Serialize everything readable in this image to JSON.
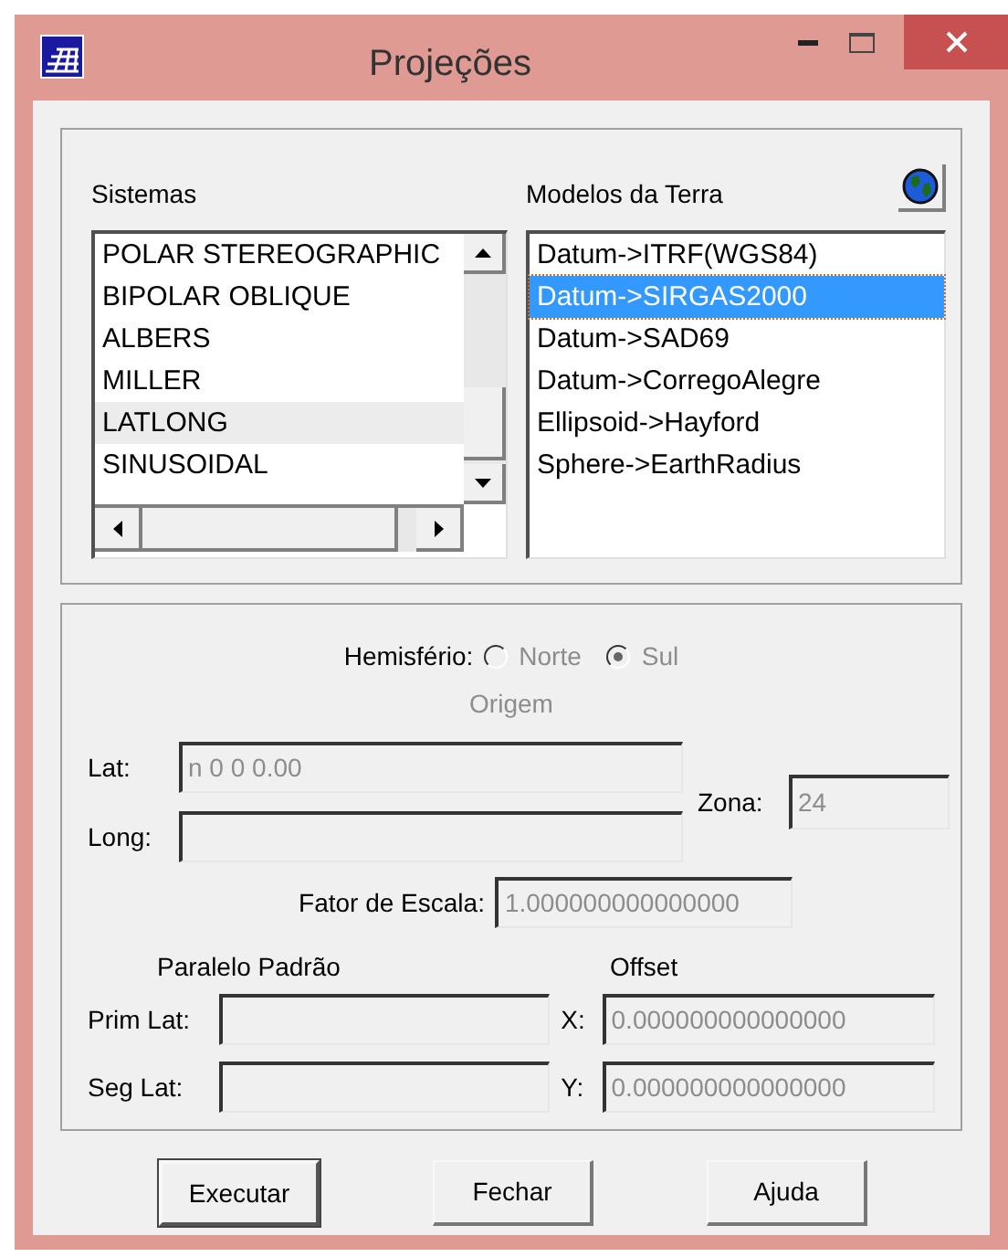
{
  "window": {
    "title": "Projeções"
  },
  "sistemas": {
    "label": "Sistemas",
    "items": [
      {
        "text": "POLAR STEREOGRAPHIC",
        "selected": false
      },
      {
        "text": "BIPOLAR OBLIQUE",
        "selected": false
      },
      {
        "text": "ALBERS",
        "selected": false
      },
      {
        "text": "MILLER",
        "selected": false
      },
      {
        "text": "LATLONG",
        "selected": true
      },
      {
        "text": "SINUSOIDAL",
        "selected": false
      }
    ]
  },
  "modelos": {
    "label": "Modelos da Terra",
    "items": [
      {
        "text": "Datum->ITRF(WGS84)",
        "selected": false
      },
      {
        "text": "Datum->SIRGAS2000",
        "selected": true
      },
      {
        "text": "Datum->SAD69",
        "selected": false
      },
      {
        "text": "Datum->CorregoAlegre",
        "selected": false
      },
      {
        "text": "Ellipsoid->Hayford",
        "selected": false
      },
      {
        "text": "Sphere->EarthRadius",
        "selected": false
      }
    ]
  },
  "hemisferio": {
    "label": "Hemisfério:",
    "disabled": true,
    "options": [
      {
        "label": "Norte",
        "selected": false
      },
      {
        "label": "Sul",
        "selected": true
      }
    ]
  },
  "origem": {
    "label": "Origem",
    "disabled": true
  },
  "lat": {
    "label": "Lat:",
    "value": "n 0 0 0.00",
    "disabled": true
  },
  "long": {
    "label": "Long:",
    "disabled": true
  },
  "zona": {
    "label": "Zona:",
    "value": "24",
    "disabled": true
  },
  "fator": {
    "label": "Fator de Escala:",
    "value": "1.000000000000000",
    "disabled": true
  },
  "paralelo": {
    "heading": "Paralelo Padrão",
    "prim": {
      "label": "Prim Lat:",
      "disabled": true
    },
    "seg": {
      "label": "Seg Lat:",
      "disabled": true
    }
  },
  "offset": {
    "heading": "Offset",
    "x": {
      "label": "X:",
      "value": "0.000000000000000",
      "disabled": true
    },
    "y": {
      "label": "Y:",
      "value": "0.000000000000000",
      "disabled": true
    }
  },
  "buttons": [
    {
      "label": "Executar",
      "default": true
    },
    {
      "label": "Fechar",
      "default": false
    },
    {
      "label": "Ajuda",
      "default": false
    }
  ]
}
